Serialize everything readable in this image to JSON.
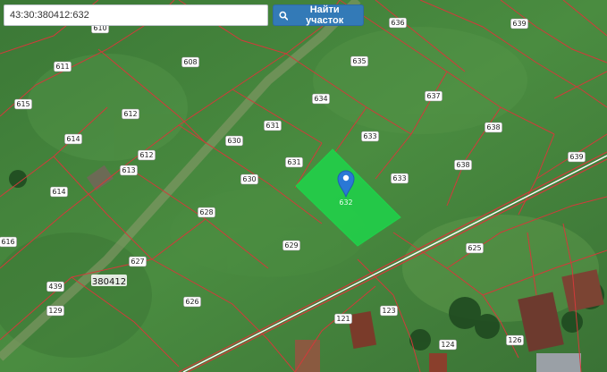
{
  "search": {
    "value": "43:30:380412:632",
    "button_label": "Найти участок",
    "button_icon": "search-icon"
  },
  "map": {
    "block_label": "380412",
    "selected_parcel": "632",
    "selected_color": "#1fd34a",
    "boundary_color": "#d23a3a",
    "marker_icon": "map-pin-icon",
    "parcel_labels": [
      "610",
      "611",
      "608",
      "636",
      "635",
      "639",
      "615",
      "612",
      "634",
      "637",
      "614",
      "631",
      "630",
      "633",
      "638",
      "613",
      "612",
      "631",
      "630",
      "633",
      "638",
      "639",
      "614",
      "628",
      "616",
      "625",
      "627",
      "629",
      "439",
      "626",
      "121",
      "123",
      "124",
      "126",
      "129"
    ]
  }
}
